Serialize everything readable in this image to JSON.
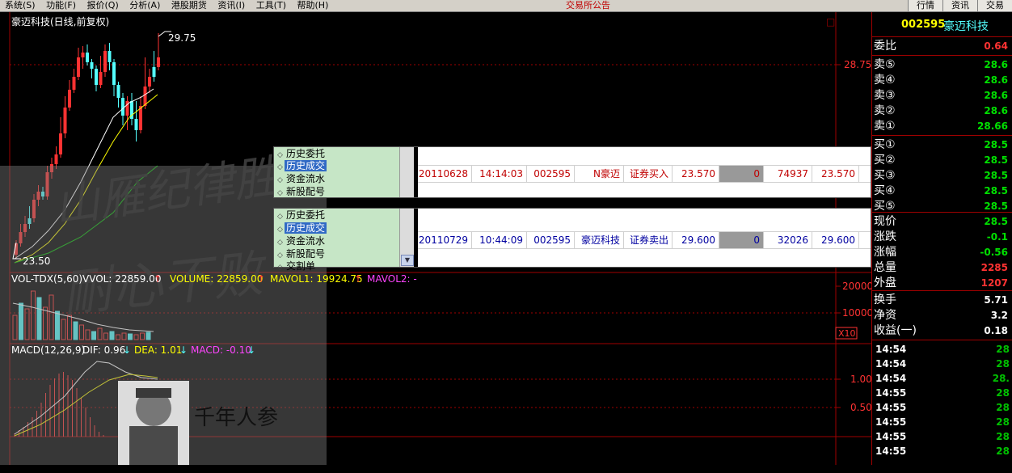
{
  "menu": {
    "items": [
      "系统(S)",
      "功能(F)",
      "报价(Q)",
      "分析(A)",
      "港股期货",
      "资讯(I)",
      "工具(T)",
      "帮助(H)"
    ],
    "notice": "交易所公告",
    "right_tabs": [
      "行情",
      "资讯",
      "交易"
    ]
  },
  "stock": {
    "title": "豪迈科技(日线,前复权)",
    "code": "002595",
    "name": "豪迈科技",
    "price_high_label": "29.75",
    "price_low_label": "23.50",
    "axis_label": "28.75",
    "box_icon": "□"
  },
  "volume": {
    "indicator": "VOL-TDX(5,60)",
    "vvol": "VVOL: 22859.00",
    "volume": "VOLUME: 22859.00",
    "mavol1": "MAVOL1: 19924.75",
    "mavol2": "MAVOL2: -",
    "axis_20000": "20000",
    "axis_10000": "10000",
    "multiplier": "X10"
  },
  "macd": {
    "indicator": "MACD(12,26,9)",
    "dif": "DIF: 0.96",
    "dea": "DEA: 1.01",
    "macd": "MACD: -0.10",
    "axis_1": "1.00",
    "axis_05": "0.50"
  },
  "watermark": {
    "calligraphy_1": "山雁纪律胜",
    "calligraphy_2": "耐心不败",
    "logo_text": "千年人参"
  },
  "trade_panel_1": {
    "nav": [
      "历史委托",
      "历史成交",
      "资金流水",
      "新股配号"
    ],
    "selected": 1,
    "row": [
      "20110628",
      "14:14:03",
      "002595",
      "N豪迈",
      "证券买入",
      "23.570",
      "0",
      "74937",
      "23.570"
    ]
  },
  "trade_panel_2": {
    "nav": [
      "历史委托",
      "历史成交",
      "资金流水",
      "新股配号",
      "交割单"
    ],
    "selected": 1,
    "row": [
      "20110729",
      "10:44:09",
      "002595",
      "豪迈科技",
      "证券卖出",
      "29.600",
      "0",
      "32026",
      "29.600"
    ]
  },
  "quote": {
    "weibi": {
      "label": "委比",
      "value": "0.64"
    },
    "sell": [
      {
        "label": "卖⑤",
        "value": "28.6"
      },
      {
        "label": "卖④",
        "value": "28.6"
      },
      {
        "label": "卖③",
        "value": "28.6"
      },
      {
        "label": "卖②",
        "value": "28.6"
      },
      {
        "label": "卖①",
        "value": "28.66"
      }
    ],
    "buy": [
      {
        "label": "买①",
        "value": "28.5"
      },
      {
        "label": "买②",
        "value": "28.5"
      },
      {
        "label": "买③",
        "value": "28.5"
      },
      {
        "label": "买④",
        "value": "28.5"
      },
      {
        "label": "买⑤",
        "value": "28.5"
      }
    ],
    "stats": [
      {
        "label": "现价",
        "value": "28.5"
      },
      {
        "label": "涨跌",
        "value": "-0.1"
      },
      {
        "label": "涨幅",
        "value": "-0.56"
      },
      {
        "label": "总量",
        "value": "2285"
      },
      {
        "label": "外盘",
        "value": "1207"
      }
    ],
    "extra": [
      {
        "label": "换手",
        "value": "5.71"
      },
      {
        "label": "净资",
        "value": "3.2"
      },
      {
        "label": "收益(一)",
        "value": "0.18"
      }
    ],
    "ticks": [
      {
        "time": "14:54",
        "price": "28"
      },
      {
        "time": "14:54",
        "price": "28"
      },
      {
        "time": "14:54",
        "price": "28."
      },
      {
        "time": "14:55",
        "price": "28"
      },
      {
        "time": "14:55",
        "price": "28"
      },
      {
        "time": "14:55",
        "price": "28"
      },
      {
        "time": "14:55",
        "price": "28"
      },
      {
        "time": "14:55",
        "price": "28"
      }
    ]
  },
  "colors": {
    "up": "#ff3232",
    "down": "#54ffff",
    "ma_white": "#ffffff",
    "ma_yellow": "#ffff00",
    "ma_green": "#00c000",
    "sell_green": "#00e000",
    "red_value": "#ff3232",
    "macd_dea": "#ffff00"
  }
}
